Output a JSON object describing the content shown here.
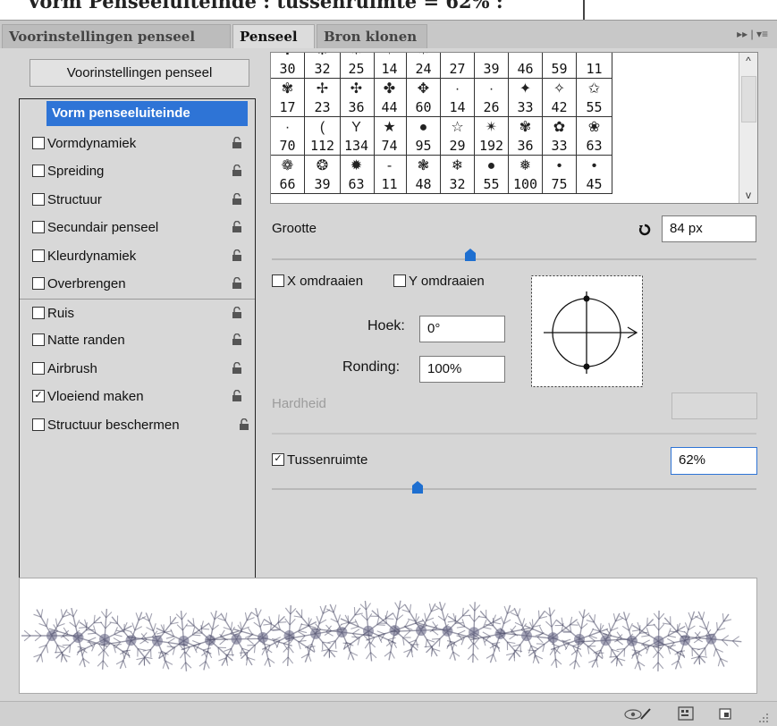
{
  "overlay_caption": "Vorm Penseeluiteinde : tussenruimte = 62% :",
  "tabs": [
    {
      "label": "Voorinstellingen penseel"
    },
    {
      "label": "Penseel"
    },
    {
      "label": "Bron klonen"
    }
  ],
  "tab_menu_icon": "panel-menu-icon",
  "preset_button": "Voorinstellingen penseel",
  "brush_options": [
    {
      "label": "Vorm penseeluiteinde",
      "selected": true
    },
    {
      "label": "Vormdynamiek",
      "checked": false
    },
    {
      "label": "Spreiding",
      "checked": false
    },
    {
      "label": "Structuur",
      "checked": false
    },
    {
      "label": "Secundair penseel",
      "checked": false
    },
    {
      "label": "Kleurdynamiek",
      "checked": false
    },
    {
      "label": "Overbrengen",
      "checked": false
    },
    {
      "label": "Ruis",
      "checked": false
    },
    {
      "label": "Natte randen",
      "checked": false
    },
    {
      "label": "Airbrush",
      "checked": false
    },
    {
      "label": "Vloeiend maken",
      "checked": true
    },
    {
      "label": "Structuur beschermen",
      "checked": false
    }
  ],
  "brush_grid": {
    "rows": [
      [
        "30",
        "32",
        "25",
        "14",
        "24",
        "27",
        "39",
        "46",
        "59",
        "11"
      ],
      [
        "17",
        "23",
        "36",
        "44",
        "60",
        "14",
        "26",
        "33",
        "42",
        "55"
      ],
      [
        "70",
        "112",
        "134",
        "74",
        "95",
        "29",
        "192",
        "36",
        "33",
        "63"
      ],
      [
        "66",
        "39",
        "63",
        "11",
        "48",
        "32",
        "55",
        "100",
        "75",
        "45"
      ]
    ]
  },
  "size": {
    "label": "Grootte",
    "value": "84 px",
    "percent": 41
  },
  "flip_x": "X omdraaien",
  "flip_y": "Y omdraaien",
  "angle": {
    "label": "Hoek:",
    "value": "0°"
  },
  "roundness": {
    "label": "Ronding:",
    "value": "100%"
  },
  "hardness": {
    "label": "Hardheid",
    "value": "",
    "disabled": true
  },
  "spacing": {
    "label": "Tussenruimte",
    "value": "62%",
    "checked": true,
    "percent": 30
  },
  "colors": {
    "accent": "#2e74d6",
    "panel": "#d6d6d6",
    "slider_thumb": "#1e6fd0"
  }
}
